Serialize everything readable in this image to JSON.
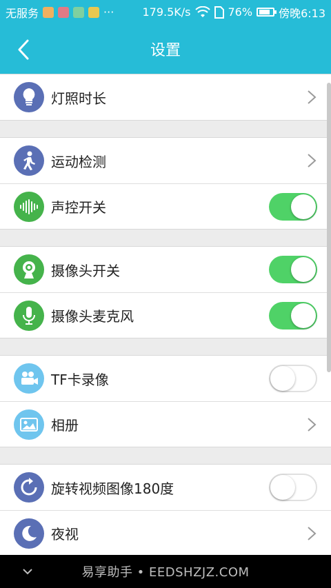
{
  "statusbar": {
    "carrier": "无服务",
    "extra": "···",
    "speed": "179.5K/s",
    "battery": "76%",
    "time": "傍晚6:13"
  },
  "header": {
    "title": "设置"
  },
  "settings": [
    {
      "label": "灯照时长",
      "icon": "lightbulb-icon",
      "color": "#5a6fb5",
      "control": "chevron"
    },
    {
      "label": "运动检测",
      "icon": "person-walking-icon",
      "color": "#5a6fb5",
      "control": "chevron"
    },
    {
      "label": "声控开关",
      "icon": "sound-wave-icon",
      "color": "#45b34b",
      "control": "toggle",
      "on": true
    },
    {
      "label": "摄像头开关",
      "icon": "webcam-icon",
      "color": "#45b34b",
      "control": "toggle",
      "on": true
    },
    {
      "label": "摄像头麦克风",
      "icon": "microphone-icon",
      "color": "#45b34b",
      "control": "toggle",
      "on": true
    },
    {
      "label": "TF卡录像",
      "icon": "video-camera-icon",
      "color": "#6fc5ee",
      "control": "toggle",
      "on": false
    },
    {
      "label": "相册",
      "icon": "image-icon",
      "color": "#6fc5ee",
      "control": "chevron"
    },
    {
      "label": "旋转视频图像180度",
      "icon": "rotate-icon",
      "color": "#5a6fb5",
      "control": "toggle",
      "on": false
    },
    {
      "label": "夜视",
      "icon": "moon-icon",
      "color": "#5a6fb5",
      "control": "chevron"
    }
  ],
  "watermark": "易享助手 • EEDSHZJZ.COM",
  "colors": {
    "header": "#26bcd7",
    "toggle_on": "#4fd267"
  }
}
